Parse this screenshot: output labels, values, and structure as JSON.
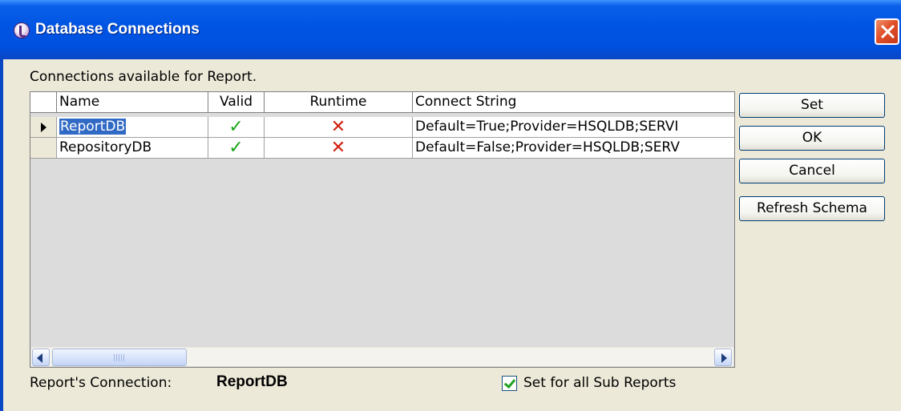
{
  "window": {
    "title": "Database Connections",
    "app_icon": "crystal-reports-icon",
    "close_icon": "close-icon"
  },
  "caption": "Connections available for Report.",
  "grid": {
    "columns": [
      "Name",
      "Valid",
      "Runtime",
      "Connect String"
    ],
    "rows": [
      {
        "name": "ReportDB",
        "valid": "✓",
        "runtime": "✕",
        "connect": "Default=True;Provider=HSQLDB;SERVI",
        "selected": true
      },
      {
        "name": "RepositoryDB",
        "valid": "✓",
        "runtime": "✕",
        "connect": "Default=False;Provider=HSQLDB;SERV",
        "selected": false
      }
    ],
    "scrollbar_grip": "III"
  },
  "buttons": {
    "set": "Set",
    "ok": "OK",
    "cancel": "Cancel",
    "refresh": "Refresh Schema"
  },
  "footer": {
    "connection_label": "Report's Connection:",
    "connection_value": "ReportDB",
    "subreports_label": "Set for all Sub Reports",
    "subreports_checked": true
  },
  "colors": {
    "titlebar": "#0054e3",
    "selection": "#316ac5",
    "valid_check": "#1aa31a",
    "runtime_cross": "#d02010"
  }
}
